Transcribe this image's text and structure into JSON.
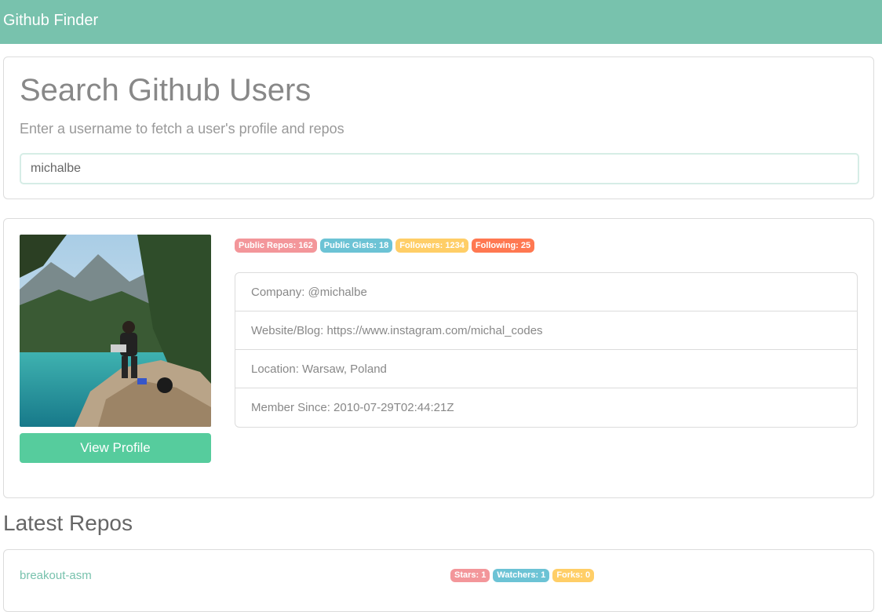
{
  "navbar": {
    "brand": "Github Finder"
  },
  "search": {
    "title": "Search Github Users",
    "subtitle": "Enter a username to fetch a user's profile and repos",
    "value": "michalbe"
  },
  "profile": {
    "view_button": "View Profile",
    "badges": [
      {
        "label": "Public Repos: 162",
        "color": "#f3969a"
      },
      {
        "label": "Public Gists: 18",
        "color": "#6cc3d5"
      },
      {
        "label": "Followers: 1234",
        "color": "#ffce67"
      },
      {
        "label": "Following: 25",
        "color": "#ff7851"
      }
    ],
    "info": [
      "Company: @michalbe",
      "Website/Blog: https://www.instagram.com/michal_codes",
      "Location: Warsaw, Poland",
      "Member Since: 2010-07-29T02:44:21Z"
    ]
  },
  "repos": {
    "heading": "Latest Repos",
    "items": [
      {
        "name": "breakout-asm",
        "badges": [
          "Stars: 1",
          "Watchers: 1",
          "Forks: 0"
        ]
      }
    ]
  },
  "colors": {
    "navbar": "#78c2ad",
    "button": "#56cc9d",
    "link": "#78c2ad"
  }
}
